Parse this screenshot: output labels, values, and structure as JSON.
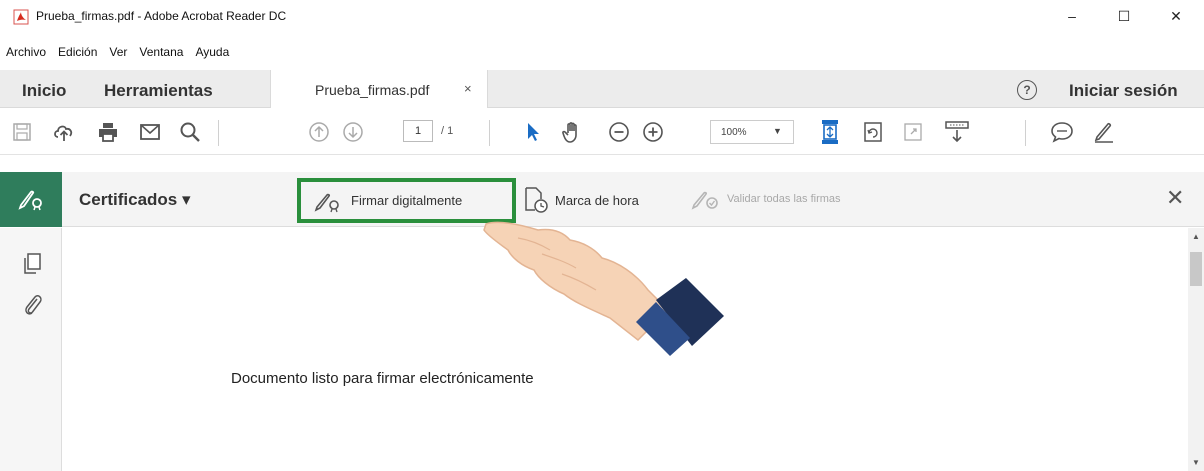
{
  "window": {
    "title": "Prueba_firmas.pdf - Adobe Acrobat Reader DC",
    "minimize": "–",
    "maximize": "☐",
    "close": "✕"
  },
  "menu": [
    "Archivo",
    "Edición",
    "Ver",
    "Ventana",
    "Ayuda"
  ],
  "tabs": {
    "home": "Inicio",
    "tools": "Herramientas",
    "document": "Prueba_firmas.pdf",
    "document_close": "×",
    "help": "?",
    "signin": "Iniciar sesión"
  },
  "toolbar": {
    "page_current": "1",
    "page_total": "/ 1",
    "zoom": "100%",
    "zoom_arrow": "▼"
  },
  "certificates": {
    "title": "Certificados ▾",
    "sign": "Firmar digitalmente",
    "timestamp": "Marca de hora",
    "validate": "Validar todas las firmas",
    "close": "✕",
    "accent_color": "#2f7d5c",
    "highlight_color": "#2a8f3c"
  },
  "document": {
    "text": "Documento listo para firmar electrónicamente"
  }
}
